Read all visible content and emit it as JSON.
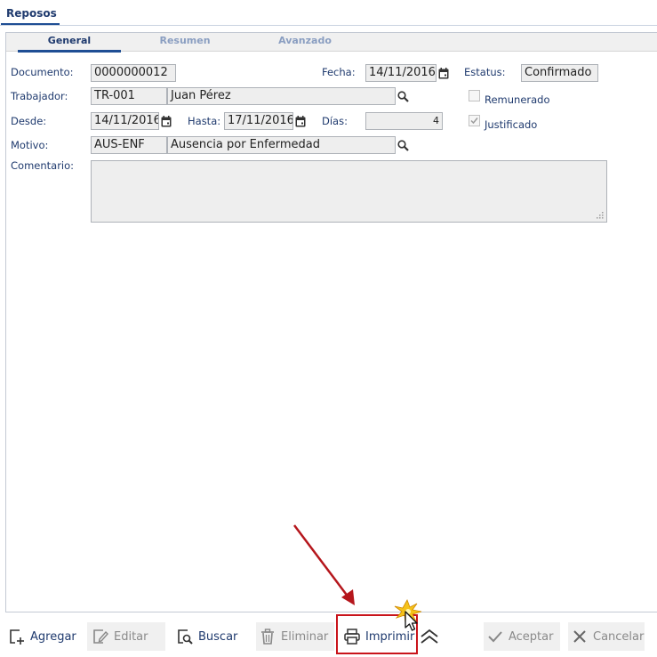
{
  "window": {
    "tab_label": "Reposos"
  },
  "subtabs": [
    {
      "label": "General"
    },
    {
      "label": "Resumen"
    },
    {
      "label": "Avanzado"
    }
  ],
  "form": {
    "documento": {
      "label": "Documento:",
      "value": "0000000012"
    },
    "fecha": {
      "label": "Fecha:",
      "value": "14/11/2016"
    },
    "estatus": {
      "label": "Estatus:",
      "value": "Confirmado"
    },
    "trabajador": {
      "label": "Trabajador:",
      "code": "TR-001",
      "name": "Juan Pérez"
    },
    "remunerado": {
      "label": "Remunerado",
      "checked": false
    },
    "desde": {
      "label": "Desde:",
      "value": "14/11/2016"
    },
    "hasta": {
      "label": "Hasta:",
      "value": "17/11/2016"
    },
    "dias": {
      "label": "Días:",
      "value": "4"
    },
    "justificado": {
      "label": "Justificado",
      "checked": true
    },
    "motivo": {
      "label": "Motivo:",
      "code": "AUS-ENF",
      "name": "Ausencia por Enfermedad"
    },
    "comentario": {
      "label": "Comentario:",
      "value": ""
    }
  },
  "toolbar": {
    "agregar": "Agregar",
    "editar": "Editar",
    "buscar": "Buscar",
    "eliminar": "Eliminar",
    "imprimir": "Imprimir",
    "aceptar": "Aceptar",
    "cancelar": "Cancelar"
  },
  "colors": {
    "accent": "#1f4e94",
    "label": "#1f3a6e",
    "annotation": "#c9141b"
  }
}
